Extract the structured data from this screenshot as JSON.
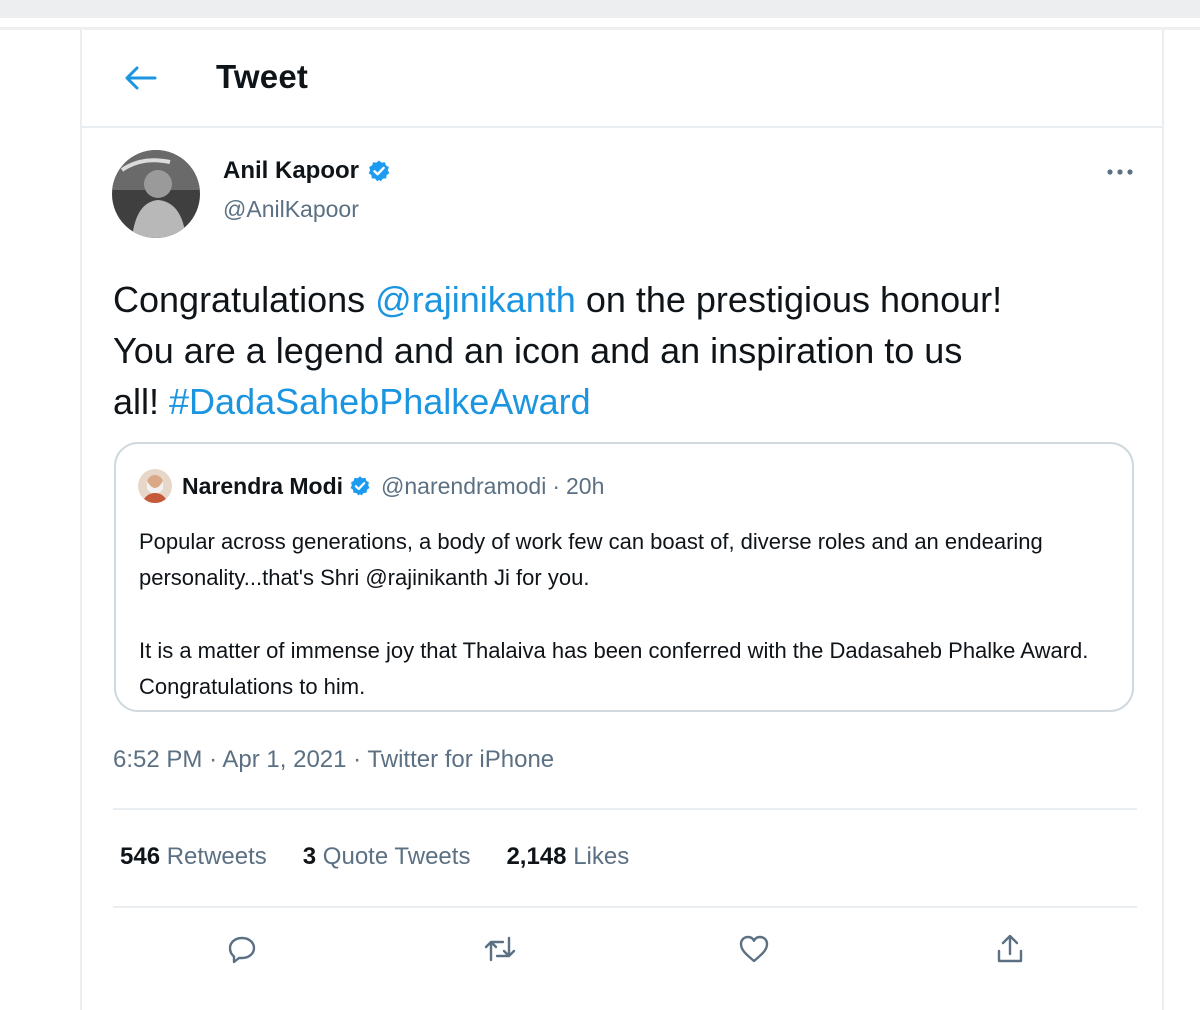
{
  "colors": {
    "accent": "#1b95e0",
    "verified": "#1d9bf0",
    "secondary_text": "#5b7083",
    "border": "#cfd9de"
  },
  "header": {
    "title": "Tweet",
    "back_icon": "arrow-left-icon"
  },
  "tweet": {
    "author": {
      "name": "Anil Kapoor",
      "handle": "@AnilKapoor",
      "verified_icon": "verified-badge-icon"
    },
    "more_icon": "more-horizontal-icon",
    "text": {
      "part1": "Congratulations ",
      "mention": "@rajinikanth",
      "part2": " on the prestigious honour! You are a legend and an icon and an inspiration to us all! ",
      "hashtag": "#DadaSahebPhalkeAward"
    },
    "quoted": {
      "name": "Narendra Modi",
      "handle": "@narendramodi",
      "separator": "·",
      "time": "20h",
      "paragraph1": "Popular across generations, a body of work few can boast of, diverse roles and an endearing personality...that's Shri @rajinikanth Ji for you.",
      "paragraph2": "It is a matter of immense joy that Thalaiva has been conferred with the Dadasaheb Phalke Award. Congratulations to him."
    },
    "meta": {
      "time": "6:52 PM",
      "separator": "·",
      "date": "Apr 1, 2021",
      "source": "Twitter for iPhone"
    },
    "stats": {
      "retweets_count": "546",
      "retweets_label": "Retweets",
      "quotes_count": "3",
      "quotes_label": "Quote Tweets",
      "likes_count": "2,148",
      "likes_label": "Likes"
    },
    "actions": {
      "reply_icon": "reply-icon",
      "retweet_icon": "retweet-icon",
      "like_icon": "heart-icon",
      "share_icon": "share-icon"
    }
  }
}
